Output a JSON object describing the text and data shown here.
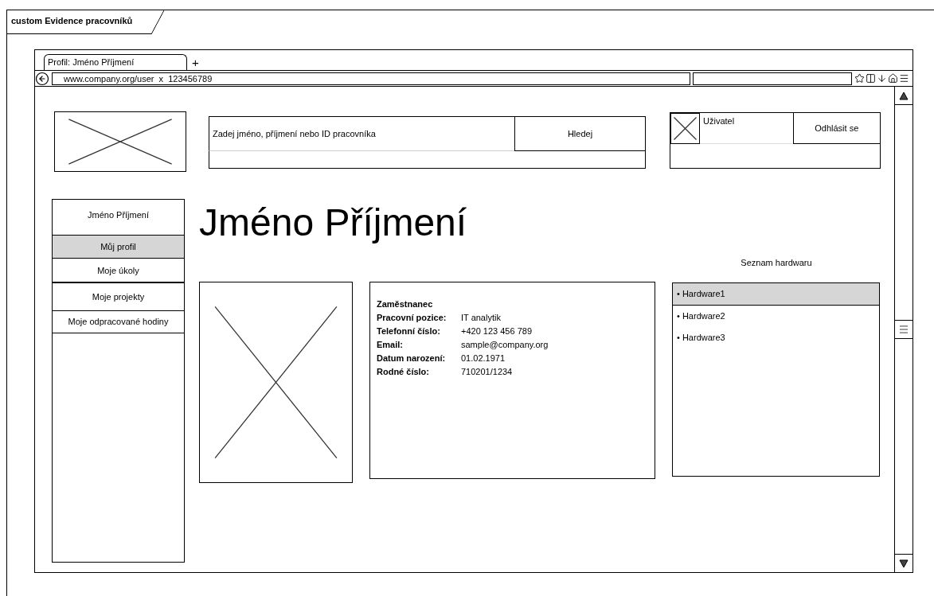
{
  "frame": {
    "title": "custom Evidence pracovníků"
  },
  "browser": {
    "tabs": [
      {
        "label": "Profil: Jméno Příjmení",
        "selected": true
      }
    ],
    "new_tab": "+",
    "address": "www.company.org/user  x  123456789"
  },
  "header": {
    "search": {
      "placeholder": "Zadej jméno, příjmení nebo ID pracovníka",
      "button": "Hledej"
    },
    "user": {
      "name": "Uživatel",
      "logout": "Odhlásit se"
    }
  },
  "sidebar": {
    "title": "Jméno Příjmení",
    "items": [
      {
        "label": "Můj profil",
        "selected": true
      },
      {
        "label": "Moje úkoly",
        "selected": false
      },
      {
        "label": "Moje projekty",
        "selected": false
      },
      {
        "label": "Moje odpracované hodiny",
        "selected": false
      }
    ]
  },
  "profile": {
    "heading": "Jméno Příjmení",
    "card_title": "Zaměstnanec",
    "fields": [
      {
        "label": "Pracovní pozice:",
        "value": "IT analytik"
      },
      {
        "label": "Telefonní číslo:",
        "value": "+420 123 456 789"
      },
      {
        "label": "Email:",
        "value": "sample@company.org"
      },
      {
        "label": "Datum narození:",
        "value": "01.02.1971"
      },
      {
        "label": "Rodné číslo:",
        "value": "710201/1234"
      }
    ]
  },
  "hardware": {
    "title": "Seznam hardwaru",
    "items": [
      {
        "label": "• Hardware1",
        "selected": true
      },
      {
        "label": "• Hardware2",
        "selected": false
      },
      {
        "label": "• Hardware3",
        "selected": false
      }
    ]
  }
}
